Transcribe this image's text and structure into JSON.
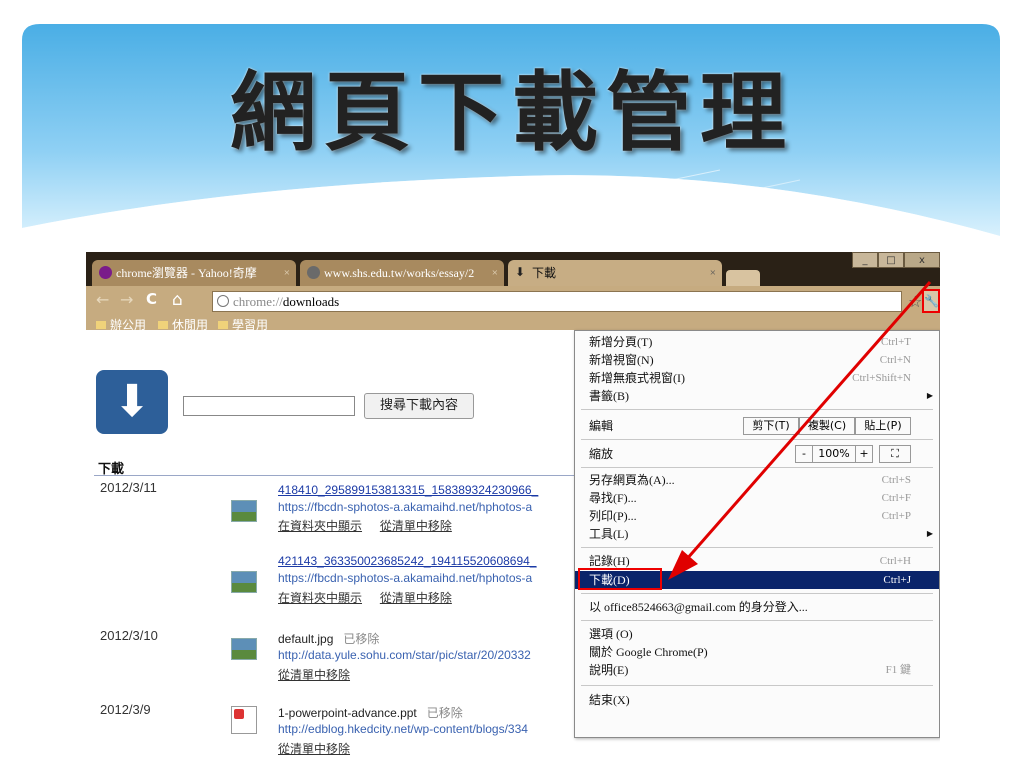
{
  "slide": {
    "title": "網頁下載管理"
  },
  "tabs": [
    {
      "label": "chrome瀏覽器 - Yahoo!奇摩",
      "close": "×"
    },
    {
      "label": "www.shs.edu.tw/works/essay/2",
      "close": "×"
    },
    {
      "label": "下載",
      "close": "×"
    }
  ],
  "window": {
    "min": "_",
    "max": "□",
    "close": "x"
  },
  "nav": {
    "back": "←",
    "forward": "→",
    "reload": "C",
    "home": "⌂"
  },
  "omnibox": {
    "scheme": "chrome://",
    "host": "downloads"
  },
  "bookmarks": [
    {
      "label": "辦公用"
    },
    {
      "label": "休閒用"
    },
    {
      "label": "學習用"
    }
  ],
  "downloads": {
    "search_button": "搜尋下載內容",
    "heading": "下載",
    "items": [
      {
        "date": "2012/3/11",
        "name": "418410_295899153813315_158389324230966_",
        "status": "",
        "url": "https://fbcdn-sphotos-a.akamaihd.net/hphotos-a",
        "show_folder": "在資料夾中顯示",
        "remove": "從清單中移除"
      },
      {
        "date": "",
        "name": "421143_363350023685242_194115520608694_",
        "status": "",
        "url": "https://fbcdn-sphotos-a.akamaihd.net/hphotos-a",
        "show_folder": "在資料夾中顯示",
        "remove": "從清單中移除"
      },
      {
        "date": "2012/3/10",
        "name": "default.jpg",
        "status": "已移除",
        "url": "http://data.yule.sohu.com/star/pic/star/20/20332",
        "show_folder": "",
        "remove": "從清單中移除"
      },
      {
        "date": "2012/3/9",
        "name": "1-powerpoint-advance.ppt",
        "status": "已移除",
        "url": "http://edblog.hkedcity.net/wp-content/blogs/334",
        "show_folder": "",
        "remove": "從清單中移除"
      }
    ]
  },
  "menu": {
    "new_tab": {
      "label": "新增分頁(T)",
      "shortcut": "Ctrl+T"
    },
    "new_window": {
      "label": "新增視窗(N)",
      "shortcut": "Ctrl+N"
    },
    "incognito": {
      "label": "新增無痕式視窗(I)",
      "shortcut": "Ctrl+Shift+N"
    },
    "bookmarks": {
      "label": "書籤(B)"
    },
    "edit": {
      "label": "編輯",
      "cut": "剪下(T)",
      "copy": "複製(C)",
      "paste": "貼上(P)"
    },
    "zoom": {
      "label": "縮放",
      "minus": "-",
      "value": "100%",
      "plus": "+",
      "fullscreen": "⛶"
    },
    "save_as": {
      "label": "另存網頁為(A)...",
      "shortcut": "Ctrl+S"
    },
    "find": {
      "label": "尋找(F)...",
      "shortcut": "Ctrl+F"
    },
    "print": {
      "label": "列印(P)...",
      "shortcut": "Ctrl+P"
    },
    "tools": {
      "label": "工具(L)"
    },
    "history": {
      "label": "記錄(H)",
      "shortcut": "Ctrl+H"
    },
    "downloads": {
      "label": "下載(D)",
      "shortcut": "Ctrl+J"
    },
    "sign_in": {
      "label": "以 office8524663@gmail.com 的身分登入..."
    },
    "options": {
      "label": "選項 (O)"
    },
    "about": {
      "label": "關於 Google Chrome(P)"
    },
    "help": {
      "label": "說明(E)",
      "shortcut": "F1 鍵"
    },
    "exit": {
      "label": "結束(X)"
    }
  },
  "colors": {
    "highlight": "#0a246a",
    "annotation_red": "#e00000",
    "frame": "#c6ab80"
  }
}
